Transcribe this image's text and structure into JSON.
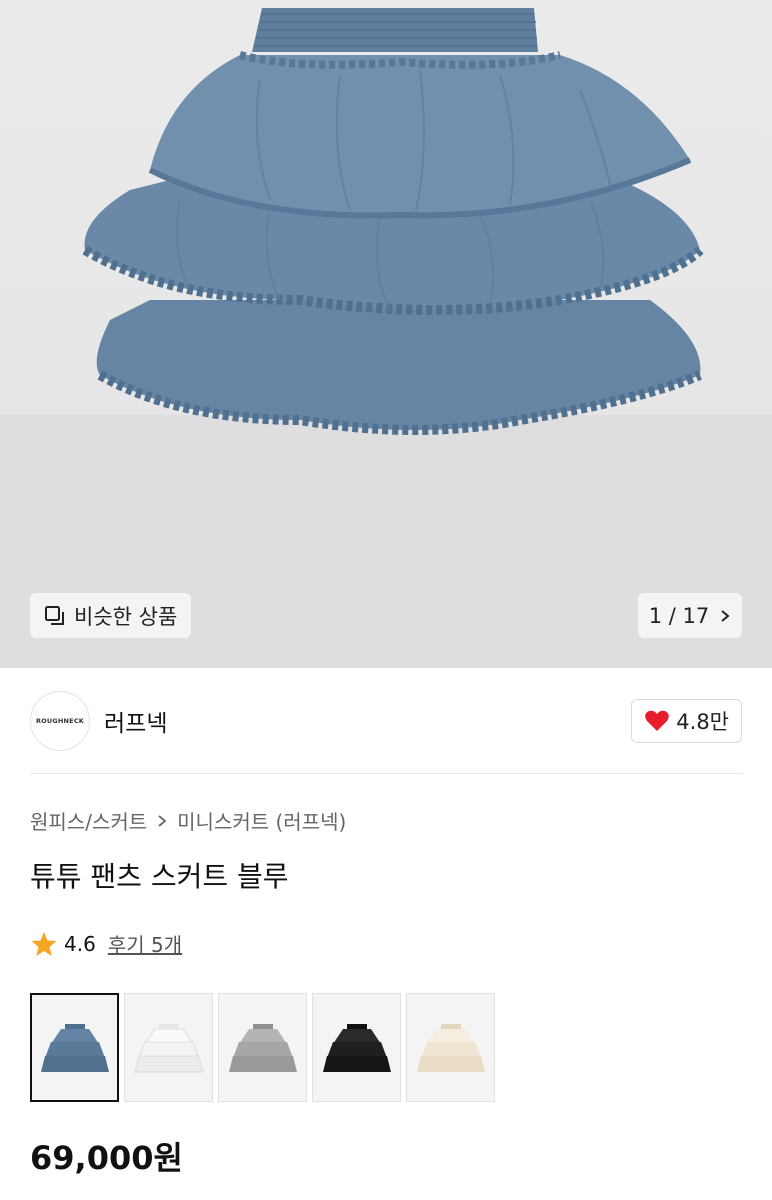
{
  "hero": {
    "similar_label": "비슷한 상품",
    "similar_icon": "copy-icon",
    "pager_text": "1 / 17",
    "pager_icon": "chevron-right-icon"
  },
  "brand": {
    "logo_text": "ROUGHNECK",
    "name": "러프넥",
    "like_count": "4.8만",
    "like_icon": "heart-icon",
    "like_color": "#e61e2b"
  },
  "breadcrumb": {
    "category": "원피스/스커트",
    "subcategory": "미니스커트 (러프넥)"
  },
  "product": {
    "title": "튜튜 팬츠 스커트 블루",
    "rating": "4.6",
    "reviews": "후기 5개",
    "star_color": "#f5a623",
    "price": "69,000원"
  },
  "thumbnails": [
    {
      "color": "#5f7f9f",
      "selected": true
    },
    {
      "color": "#f2f2f2",
      "selected": false
    },
    {
      "color": "#a9a9a9",
      "selected": false
    },
    {
      "color": "#1c1c1c",
      "selected": false
    },
    {
      "color": "#f1e8d8",
      "selected": false
    }
  ]
}
